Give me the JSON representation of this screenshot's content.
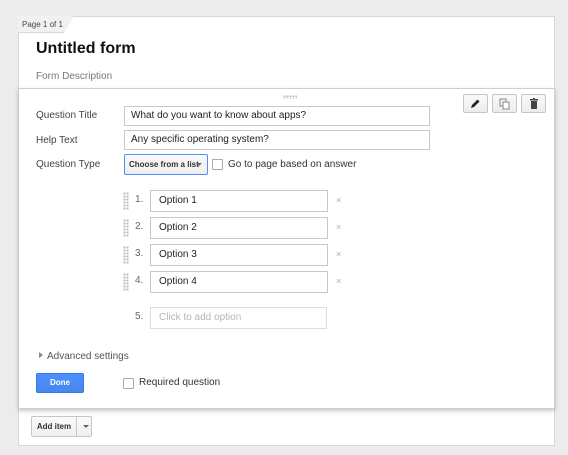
{
  "page": {
    "indicator": "Page 1 of 1"
  },
  "form": {
    "title": "Untitled form",
    "description_placeholder": "Form Description"
  },
  "editor": {
    "question_title_label": "Question Title",
    "question_title_value": "What do you want to know about apps?",
    "help_text_label": "Help Text",
    "help_text_value": "Any specific operating system?",
    "question_type_label": "Question Type",
    "question_type_value": "Choose from a list",
    "go_to_page_label": "Go to page based on answer",
    "go_to_page_checked": false,
    "toolbar": {
      "edit_icon": "pencil-icon",
      "duplicate_icon": "duplicate-icon",
      "delete_icon": "trash-icon"
    },
    "options": [
      {
        "number": "1.",
        "value": "Option 1",
        "remove": "×"
      },
      {
        "number": "2.",
        "value": "Option 2",
        "remove": "×"
      },
      {
        "number": "3.",
        "value": "Option 3",
        "remove": "×"
      },
      {
        "number": "4.",
        "value": "Option 4",
        "remove": "×"
      }
    ],
    "add_option": {
      "number": "5.",
      "placeholder": "Click to add option"
    },
    "advanced_settings_label": "Advanced settings",
    "done_label": "Done",
    "required_label": "Required question",
    "required_checked": false
  },
  "footer": {
    "add_item_label": "Add item"
  },
  "colors": {
    "accent": "#4d90fe",
    "background": "#ececec",
    "card": "#ffffff"
  }
}
